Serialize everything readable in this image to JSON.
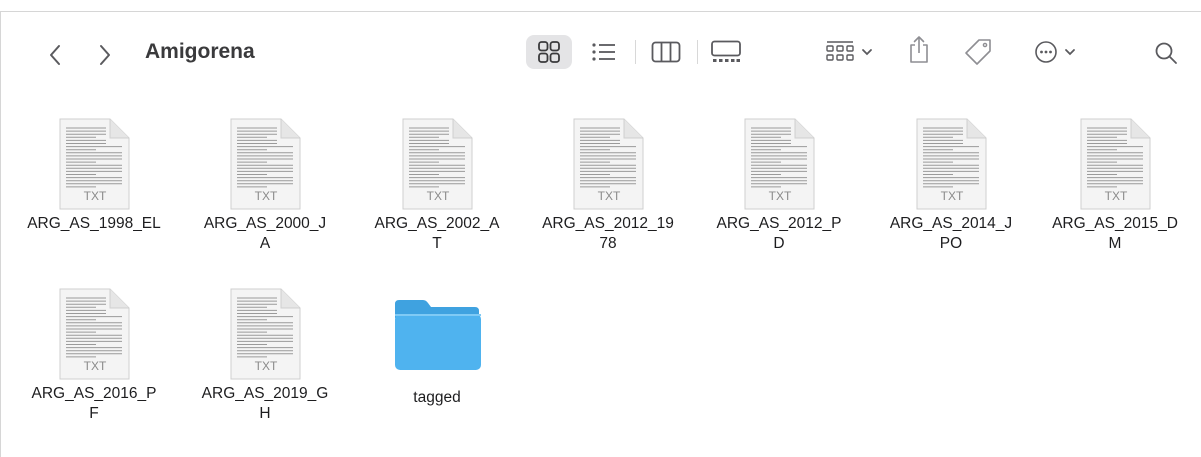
{
  "window": {
    "title": "Amigorena"
  },
  "toolbar": {
    "back_icon": "chevron-left-icon",
    "forward_icon": "chevron-right-icon",
    "views": [
      "icon-view-icon",
      "list-view-icon",
      "column-view-icon",
      "gallery-view-icon"
    ],
    "active_view": "icon-view-icon",
    "group_icon": "group-by-icon",
    "share_icon": "share-icon",
    "tag_icon": "tag-icon",
    "more_icon": "ellipsis-circle-icon",
    "search_icon": "search-icon"
  },
  "files": [
    {
      "name": "ARG_AS_1998_EL",
      "type": "txt",
      "badge": "TXT"
    },
    {
      "name": "ARG_AS_2000_J\nA",
      "type": "txt",
      "badge": "TXT"
    },
    {
      "name": "ARG_AS_2002_A\nT",
      "type": "txt",
      "badge": "TXT"
    },
    {
      "name": "ARG_AS_2012_19\n78",
      "type": "txt",
      "badge": "TXT"
    },
    {
      "name": "ARG_AS_2012_P\nD",
      "type": "txt",
      "badge": "TXT"
    },
    {
      "name": "ARG_AS_2014_J\nPO",
      "type": "txt",
      "badge": "TXT"
    },
    {
      "name": "ARG_AS_2015_D\nM",
      "type": "txt",
      "badge": "TXT"
    },
    {
      "name": "ARG_AS_2016_P\nF",
      "type": "txt",
      "badge": "TXT"
    },
    {
      "name": "ARG_AS_2019_G\nH",
      "type": "txt",
      "badge": "TXT"
    },
    {
      "name": "tagged",
      "type": "folder"
    }
  ],
  "colors": {
    "folder": "#4fb3ef",
    "folder_tab": "#3fa2e0",
    "accent": "#3a3a3c"
  }
}
